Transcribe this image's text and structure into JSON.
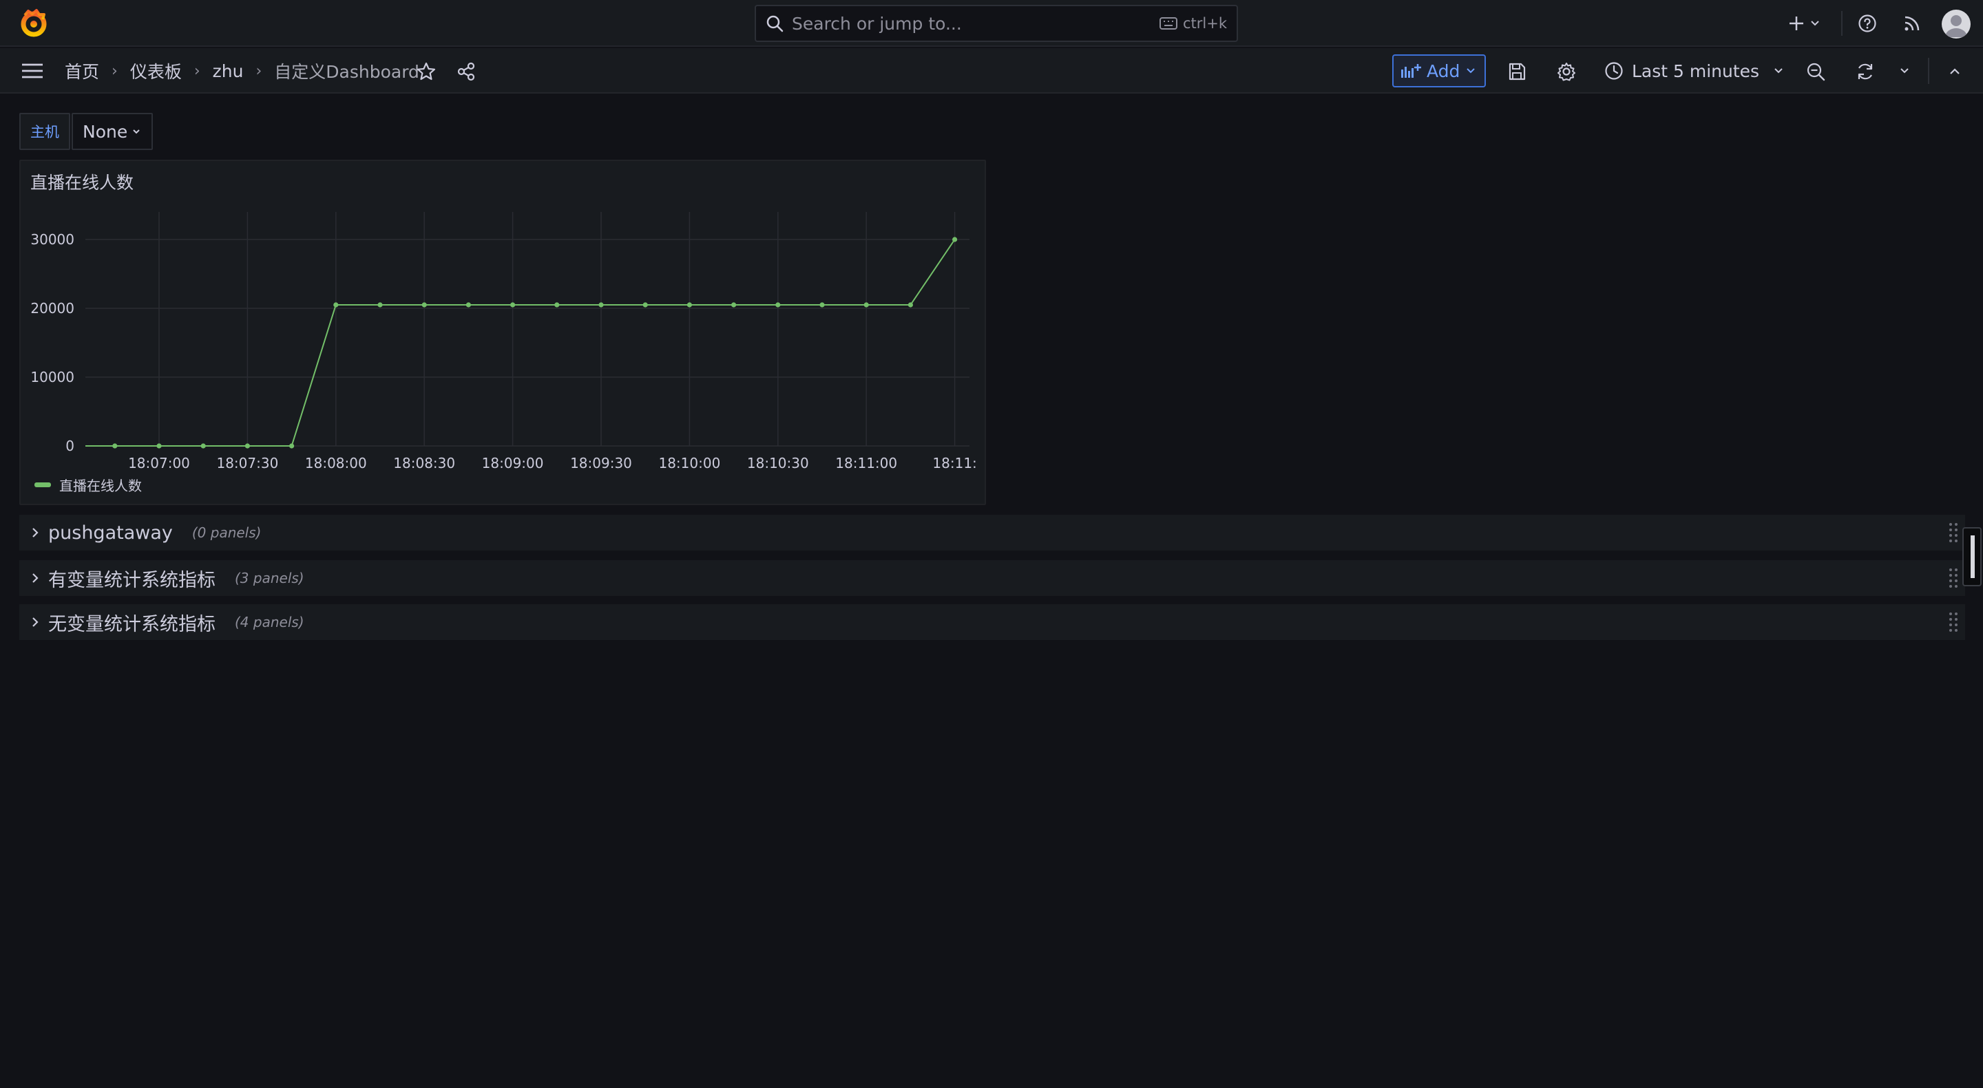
{
  "topbar": {
    "search_placeholder": "Search or jump to...",
    "search_shortcut": "ctrl+k",
    "icons": [
      "grafana-logo-icon",
      "search-icon",
      "keyboard-icon",
      "plus-icon",
      "chevron-down-icon",
      "help-icon",
      "news-rss-icon",
      "user-avatar"
    ]
  },
  "navbar": {
    "breadcrumbs": [
      "首页",
      "仪表板",
      "zhu",
      "自定义Dashboard"
    ],
    "add_label": "Add",
    "time_range": "Last 5 minutes",
    "icons": [
      "menu-icon",
      "star-icon",
      "share-icon",
      "add-panel-icon",
      "save-icon",
      "gear-icon",
      "clock-icon",
      "zoom-out-icon",
      "refresh-icon",
      "chevron-down-icon",
      "chevron-up-icon"
    ]
  },
  "variables": {
    "host_label": "主机",
    "host_value": "None"
  },
  "panel": {
    "title": "直播在线人数",
    "legend": "直播在线人数"
  },
  "chart_data": {
    "type": "line",
    "title": "直播在线人数",
    "xlabel": "",
    "ylabel": "",
    "x_ticks": [
      "18:07:00",
      "18:07:30",
      "18:08:00",
      "18:08:30",
      "18:09:00",
      "18:09:30",
      "18:10:00",
      "18:10:30",
      "18:11:00",
      "18:11:"
    ],
    "y_ticks": [
      0,
      10000,
      20000,
      30000
    ],
    "ylim": [
      0,
      33000
    ],
    "x_range_seconds": [
      "18:06:35",
      "18:11:35"
    ],
    "series": [
      {
        "name": "直播在线人数",
        "color": "#73bf69",
        "points": [
          [
            "18:06:45",
            0
          ],
          [
            "18:07:00",
            0
          ],
          [
            "18:07:15",
            0
          ],
          [
            "18:07:30",
            0
          ],
          [
            "18:07:45",
            0
          ],
          [
            "18:08:00",
            20500
          ],
          [
            "18:08:15",
            20500
          ],
          [
            "18:08:30",
            20500
          ],
          [
            "18:08:45",
            20500
          ],
          [
            "18:09:00",
            20500
          ],
          [
            "18:09:15",
            20500
          ],
          [
            "18:09:30",
            20500
          ],
          [
            "18:09:45",
            20500
          ],
          [
            "18:10:00",
            20500
          ],
          [
            "18:10:15",
            20500
          ],
          [
            "18:10:30",
            20500
          ],
          [
            "18:10:45",
            20500
          ],
          [
            "18:11:00",
            20500
          ],
          [
            "18:11:15",
            20500
          ],
          [
            "18:11:30",
            30000
          ]
        ]
      }
    ],
    "grid": true,
    "legend_position": "bottom-left"
  },
  "rows": [
    {
      "title": "pushgataway",
      "count": "(0 panels)"
    },
    {
      "title": "有变量统计系统指标",
      "count": "(3 panels)"
    },
    {
      "title": "无变量统计系统指标",
      "count": "(4 panels)"
    }
  ]
}
